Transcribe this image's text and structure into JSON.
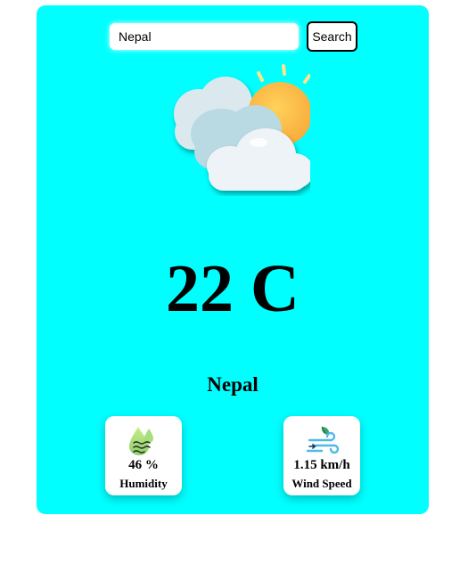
{
  "search": {
    "value": "Nepal",
    "button_label": "Search"
  },
  "weather": {
    "condition_icon": "partly-cloudy-sun-icon",
    "temperature": "22 C",
    "city": "Nepal"
  },
  "details": {
    "humidity": {
      "icon": "humidity-drop-icon",
      "value": "46 %",
      "label": "Humidity"
    },
    "wind": {
      "icon": "wind-icon",
      "value": "1.15 km/h",
      "label": "Wind Speed"
    }
  },
  "colors": {
    "card_background": "#00ffff",
    "page_background": "#ffffff",
    "sun": "#fbbf3f",
    "sun_rays": "#fde68a",
    "cloud": "#eef3f7",
    "cloud_shadow": "#b9d9e3"
  }
}
